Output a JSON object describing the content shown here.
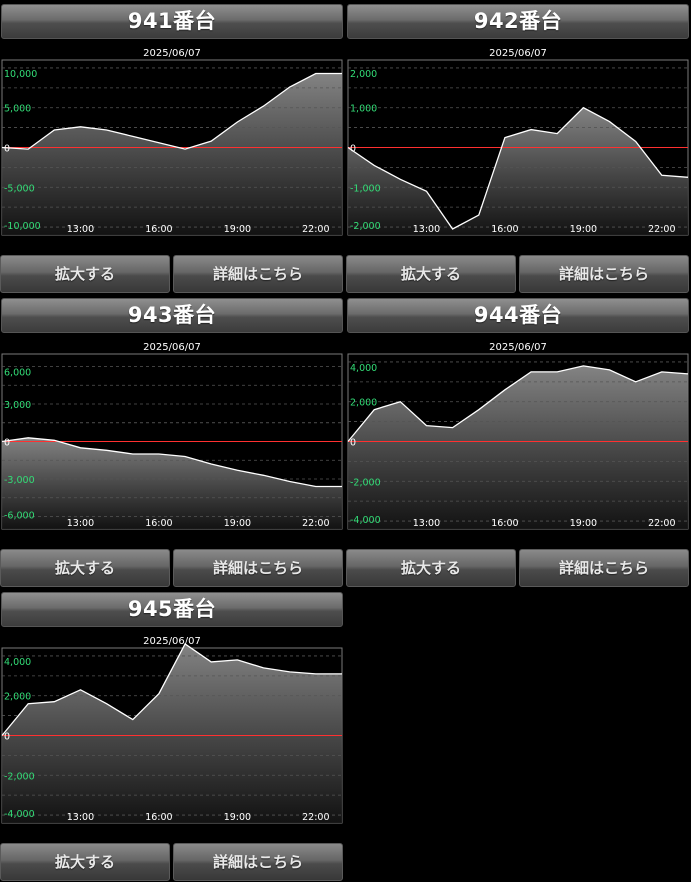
{
  "buttons": {
    "zoom_label": "拡大する",
    "detail_label": "詳細はこちら"
  },
  "colors": {
    "background": "#000000",
    "zero_line": "#ff3030",
    "positive_tick": "#33dd77",
    "line": "#ffffff"
  },
  "panels": [
    {
      "title": "941番台",
      "chart_data": {
        "type": "area",
        "title": "2025/06/07",
        "x": [
          10,
          11,
          12,
          13,
          14,
          15,
          16,
          17,
          18,
          19,
          20,
          21,
          22,
          23
        ],
        "x_ticks": [
          13,
          16,
          19,
          22
        ],
        "x_tick_labels": [
          "13:00",
          "16:00",
          "19:00",
          "22:00"
        ],
        "values": [
          0,
          -200,
          2200,
          2600,
          2200,
          1400,
          600,
          -200,
          800,
          3200,
          5200,
          7600,
          9300,
          9300
        ],
        "ylim": [
          -11000,
          11000
        ],
        "y_ticks": [
          -10000,
          -5000,
          0,
          5000,
          10000
        ],
        "y_tick_labels": [
          "-10,000",
          "-5,000",
          "0",
          "5,000",
          "10,000"
        ],
        "grid": true
      }
    },
    {
      "title": "942番台",
      "chart_data": {
        "type": "area",
        "title": "2025/06/07",
        "x": [
          10,
          11,
          12,
          13,
          14,
          15,
          16,
          17,
          18,
          19,
          20,
          21,
          22,
          23
        ],
        "x_ticks": [
          13,
          16,
          19,
          22
        ],
        "x_tick_labels": [
          "13:00",
          "16:00",
          "19:00",
          "22:00"
        ],
        "values": [
          0,
          -450,
          -800,
          -1100,
          -2050,
          -1700,
          250,
          450,
          350,
          1000,
          650,
          150,
          -700,
          -750
        ],
        "ylim": [
          -2200,
          2200
        ],
        "y_ticks": [
          -2000,
          -1000,
          0,
          1000,
          2000
        ],
        "y_tick_labels": [
          "-2,000",
          "-1,000",
          "0",
          "1,000",
          "2,000"
        ],
        "grid": true
      }
    },
    {
      "title": "943番台",
      "chart_data": {
        "type": "area",
        "title": "2025/06/07",
        "x": [
          10,
          11,
          12,
          13,
          14,
          15,
          16,
          17,
          18,
          19,
          20,
          21,
          22,
          23
        ],
        "x_ticks": [
          13,
          16,
          19,
          22
        ],
        "x_tick_labels": [
          "13:00",
          "16:00",
          "19:00",
          "22:00"
        ],
        "values": [
          0,
          300,
          100,
          -500,
          -700,
          -1000,
          -1000,
          -1200,
          -1800,
          -2300,
          -2700,
          -3200,
          -3600,
          -3600
        ],
        "ylim": [
          -7000,
          7000
        ],
        "y_ticks": [
          -6000,
          -3000,
          0,
          3000,
          6000
        ],
        "y_tick_labels": [
          "-6,000",
          "-3,000",
          "0",
          "3,000",
          "6,000"
        ],
        "grid": true
      }
    },
    {
      "title": "944番台",
      "chart_data": {
        "type": "area",
        "title": "2025/06/07",
        "x": [
          10,
          11,
          12,
          13,
          14,
          15,
          16,
          17,
          18,
          19,
          20,
          21,
          22,
          23
        ],
        "x_ticks": [
          13,
          16,
          19,
          22
        ],
        "x_tick_labels": [
          "13:00",
          "16:00",
          "19:00",
          "22:00"
        ],
        "values": [
          0,
          1600,
          2000,
          800,
          700,
          1600,
          2600,
          3500,
          3500,
          3800,
          3600,
          3000,
          3500,
          3400
        ],
        "ylim": [
          -4400,
          4400
        ],
        "y_ticks": [
          -4000,
          -2000,
          0,
          2000,
          4000
        ],
        "y_tick_labels": [
          "-4,000",
          "-2,000",
          "0",
          "2,000",
          "4,000"
        ],
        "grid": true
      }
    },
    {
      "title": "945番台",
      "chart_data": {
        "type": "area",
        "title": "2025/06/07",
        "x": [
          10,
          11,
          12,
          13,
          14,
          15,
          16,
          17,
          18,
          19,
          20,
          21,
          22,
          23
        ],
        "x_ticks": [
          13,
          16,
          19,
          22
        ],
        "x_tick_labels": [
          "13:00",
          "16:00",
          "19:00",
          "22:00"
        ],
        "values": [
          0,
          1600,
          1700,
          2300,
          1600,
          800,
          2100,
          4600,
          3700,
          3800,
          3400,
          3200,
          3100,
          3100
        ],
        "ylim": [
          -4400,
          4400
        ],
        "y_ticks": [
          -4000,
          -2000,
          0,
          2000,
          4000
        ],
        "y_tick_labels": [
          "-4,000",
          "-2,000",
          "0",
          "2,000",
          "4,000"
        ],
        "grid": true
      }
    }
  ]
}
